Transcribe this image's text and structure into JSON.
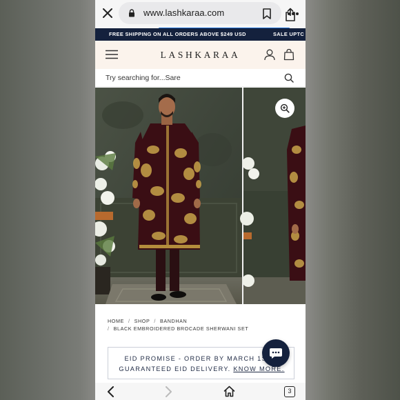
{
  "browser": {
    "url": "www.lashkaraa.com",
    "tab_count": "3"
  },
  "banner": {
    "text": "FREE SHIPPING ON ALL ORDERS ABOVE $249 USD",
    "text_next": "SALE UPTC"
  },
  "header": {
    "brand": "LASHKARAA"
  },
  "search": {
    "placeholder": "Try searching for...Sare"
  },
  "breadcrumb": {
    "items": [
      "HOME",
      "SHOP",
      "BANDHAN"
    ],
    "current": "BLACK EMBROIDERED BROCADE SHERWANI SET"
  },
  "promo": {
    "line1": "EID PROMISE - ORDER BY MARCH 1ST F",
    "line2_prefix": "GUARANTEED EID DELIVERY. ",
    "line2_link": "KNOW MORE."
  },
  "icons": {
    "close": "close-icon",
    "lock": "lock-icon",
    "bookmark": "bookmark-icon",
    "share": "share-icon",
    "more": "more-icon",
    "menu": "menu-icon",
    "account": "account-icon",
    "cart": "cart-icon",
    "search": "search-icon",
    "zoom": "zoom-in-icon",
    "chat": "chat-icon",
    "back": "back-icon",
    "forward": "forward-icon",
    "home": "home-icon"
  },
  "colors": {
    "banner_bg": "#14213d",
    "header_bg": "#fbf3ec",
    "accent": "#1a6fd8"
  }
}
